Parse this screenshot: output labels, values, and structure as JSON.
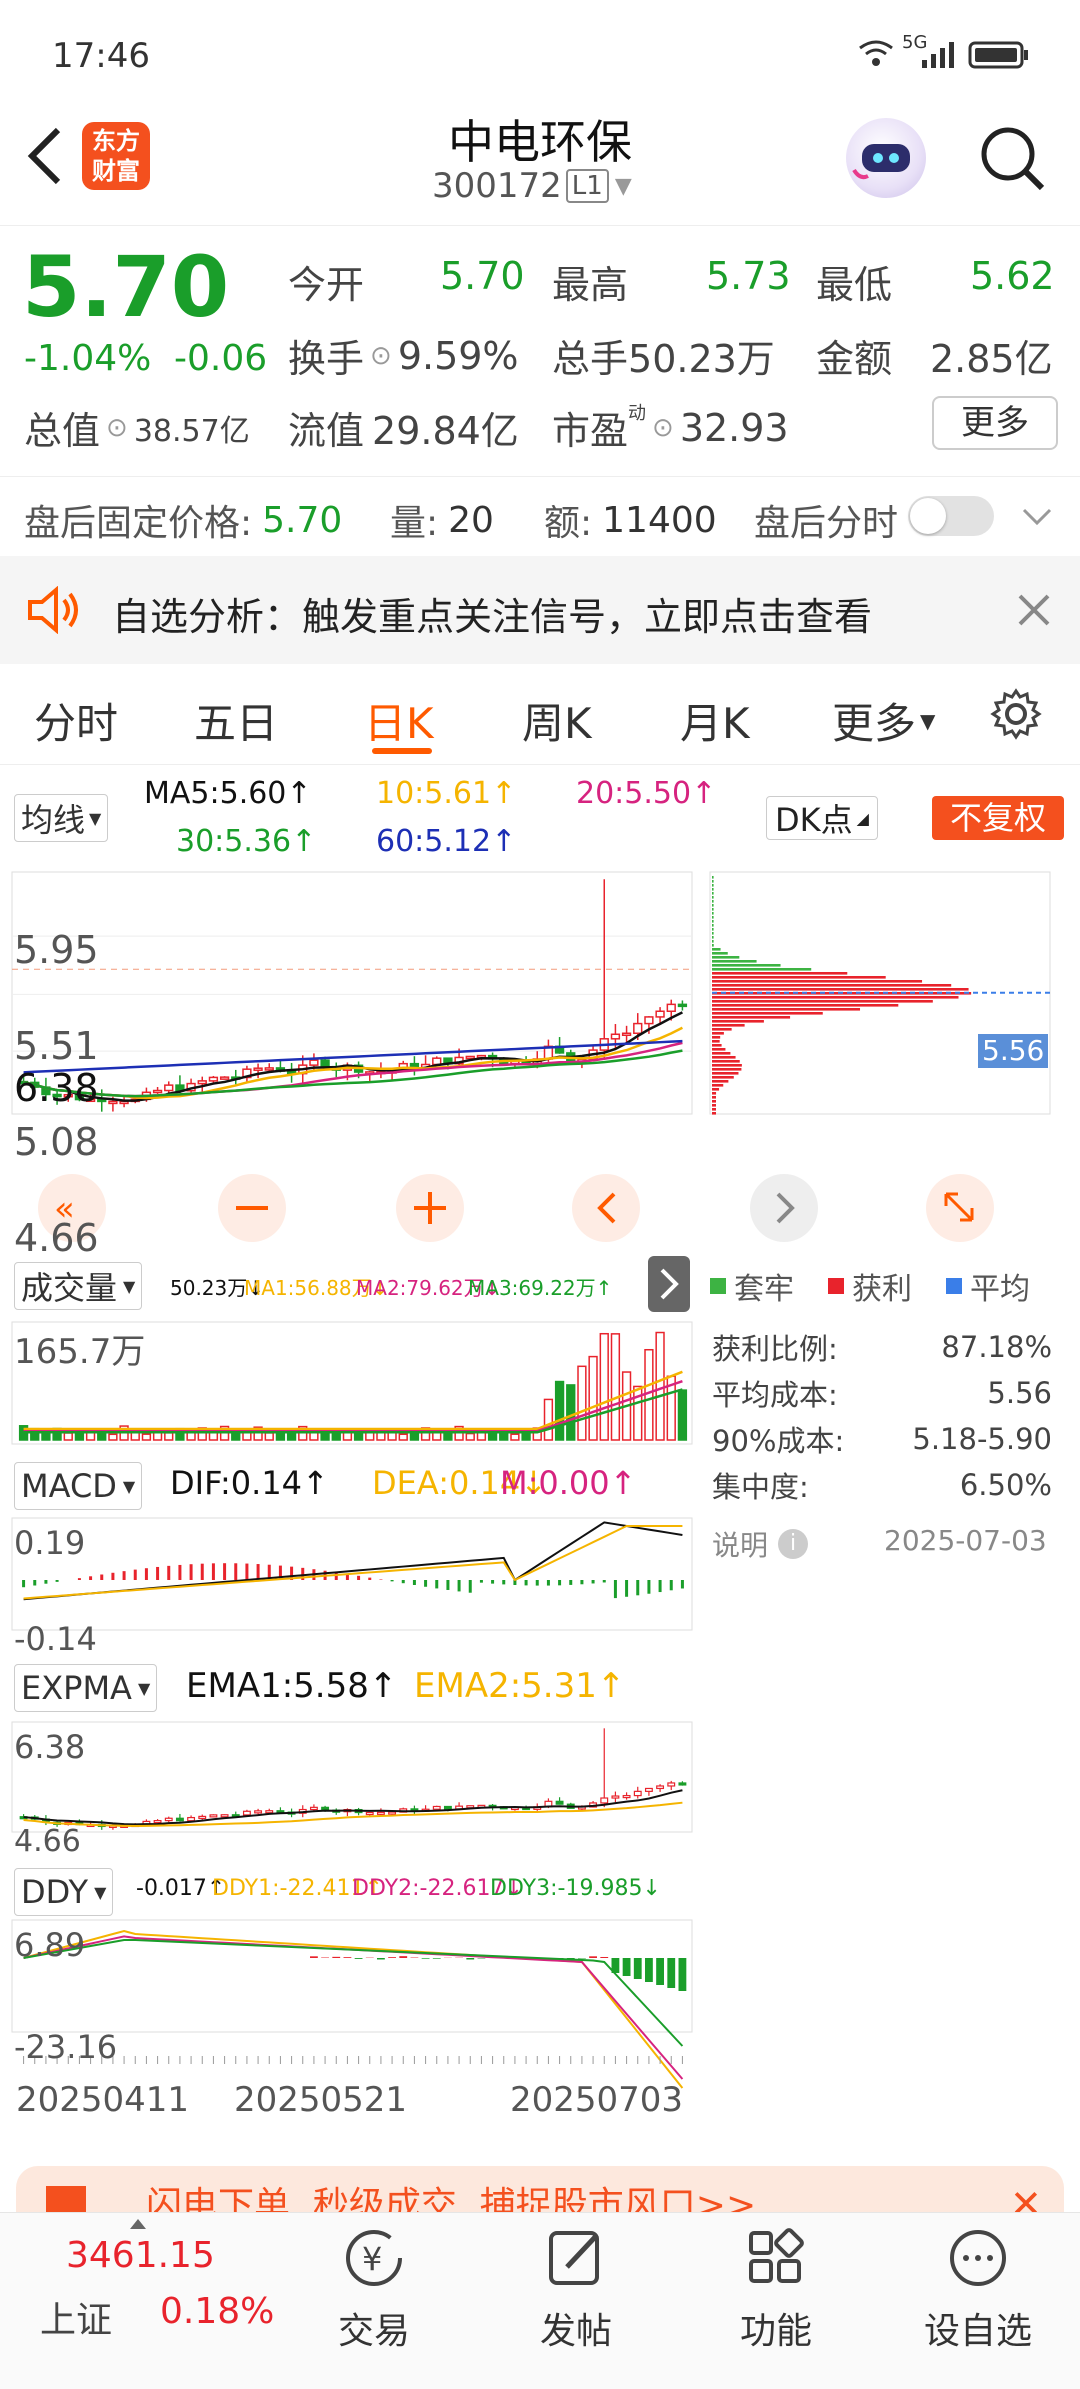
{
  "status_bar": {
    "time": "17:46",
    "network": "5G"
  },
  "header": {
    "title": "中电环保",
    "code": "300172",
    "level": "L1",
    "logo_text_1": "东方",
    "logo_text_2": "财富"
  },
  "quote": {
    "price": "5.70",
    "change_pct": "-1.04%",
    "change": "-0.06",
    "open_label": "今开",
    "open": "5.70",
    "high_label": "最高",
    "high": "5.73",
    "low_label": "最低",
    "low": "5.62",
    "turnover_label": "换手",
    "turnover": "9.59%",
    "volume_label": "总手",
    "volume": "50.23万",
    "amount_label": "金额",
    "amount": "2.85亿",
    "mktcap_label": "总值",
    "mktcap": "38.57亿",
    "float_label": "流值",
    "float_value": "29.84亿",
    "pe_label": "市盈",
    "pe_sup": "动",
    "pe": "32.93",
    "more_label": "更多"
  },
  "after_hours": {
    "price_label": "盘后固定价格:",
    "price": "5.70",
    "vol_label": "量:",
    "vol": "20",
    "amt_label": "额:",
    "amt": "11400",
    "toggle_label": "盘后分时"
  },
  "notice": {
    "text": "自选分析：触发重点关注信号，立即点击查看"
  },
  "tabs": [
    {
      "label": "分时"
    },
    {
      "label": "五日"
    },
    {
      "label": "日K"
    },
    {
      "label": "周K"
    },
    {
      "label": "月K"
    },
    {
      "label": "更多"
    }
  ],
  "ma_bar": {
    "selector": "均线",
    "ma5": "MA5:5.60↑",
    "ma10": "10:5.61↑",
    "ma20": "20:5.50↑",
    "ma30": "30:5.36↑",
    "ma60": "60:5.12↑",
    "dk_label": "DK点",
    "fuquan_label": "不复权"
  },
  "kline": {
    "y_labels": [
      "6.38",
      "5.95",
      "5.51",
      "5.08",
      "4.66"
    ]
  },
  "volume_panel": {
    "selector": "成交量",
    "v": "50.23万↓",
    "ma1": "MA1:56.88万↓",
    "ma2": "MA2:79.62万↓",
    "ma3": "MA3:69.22万↑",
    "y_label": "165.7万"
  },
  "macd_panel": {
    "selector": "MACD",
    "dif": "DIF:0.14↑",
    "dea": "DEA:0.14↓",
    "m": "M:0.00↑",
    "y_top": "0.19",
    "y_bottom": "-0.14"
  },
  "expma_panel": {
    "selector": "EXPMA",
    "ema1": "EMA1:5.58↑",
    "ema2": "EMA2:5.31↑",
    "y_top": "6.38",
    "y_bottom": "4.66"
  },
  "ddy_panel": {
    "selector": "DDY",
    "v": "-0.017↑",
    "ddy1": "DDY1:-22.411↑",
    "ddy2": "DDY2:-22.617↓",
    "ddy3": "DDY3:-19.985↓",
    "y_top": "6.89",
    "y_bottom": "-23.16"
  },
  "dates": [
    "20250411",
    "20250521",
    "20250703"
  ],
  "chip": {
    "price_tag": "5.56",
    "legend": [
      "套牢",
      "获利",
      "平均"
    ],
    "stats": [
      {
        "label": "获利比例:",
        "value": "87.18%"
      },
      {
        "label": "平均成本:",
        "value": "5.56"
      },
      {
        "label": "90%成本:",
        "value": "5.18-5.90"
      },
      {
        "label": "集中度:",
        "value": "6.50%"
      }
    ],
    "note_label": "说明",
    "date": "2025-07-03"
  },
  "banner": {
    "text": "闪电下单  秒级成交  捕捉股市风口>>"
  },
  "bottom_nav": {
    "index_value": "3461.15",
    "index_name": "上证",
    "index_change": "0.18%",
    "items": [
      {
        "label": "交易"
      },
      {
        "label": "发帖"
      },
      {
        "label": "功能"
      },
      {
        "label": "设自选"
      }
    ]
  },
  "colors": {
    "up": "#e8232c",
    "down": "#1a9e2a",
    "accent": "#ff5a00",
    "ma5": "#111111",
    "ma10": "#f5b400",
    "ma20": "#d6237f",
    "ma30": "#1a9e2a",
    "ma60": "#1d2fb5"
  }
}
